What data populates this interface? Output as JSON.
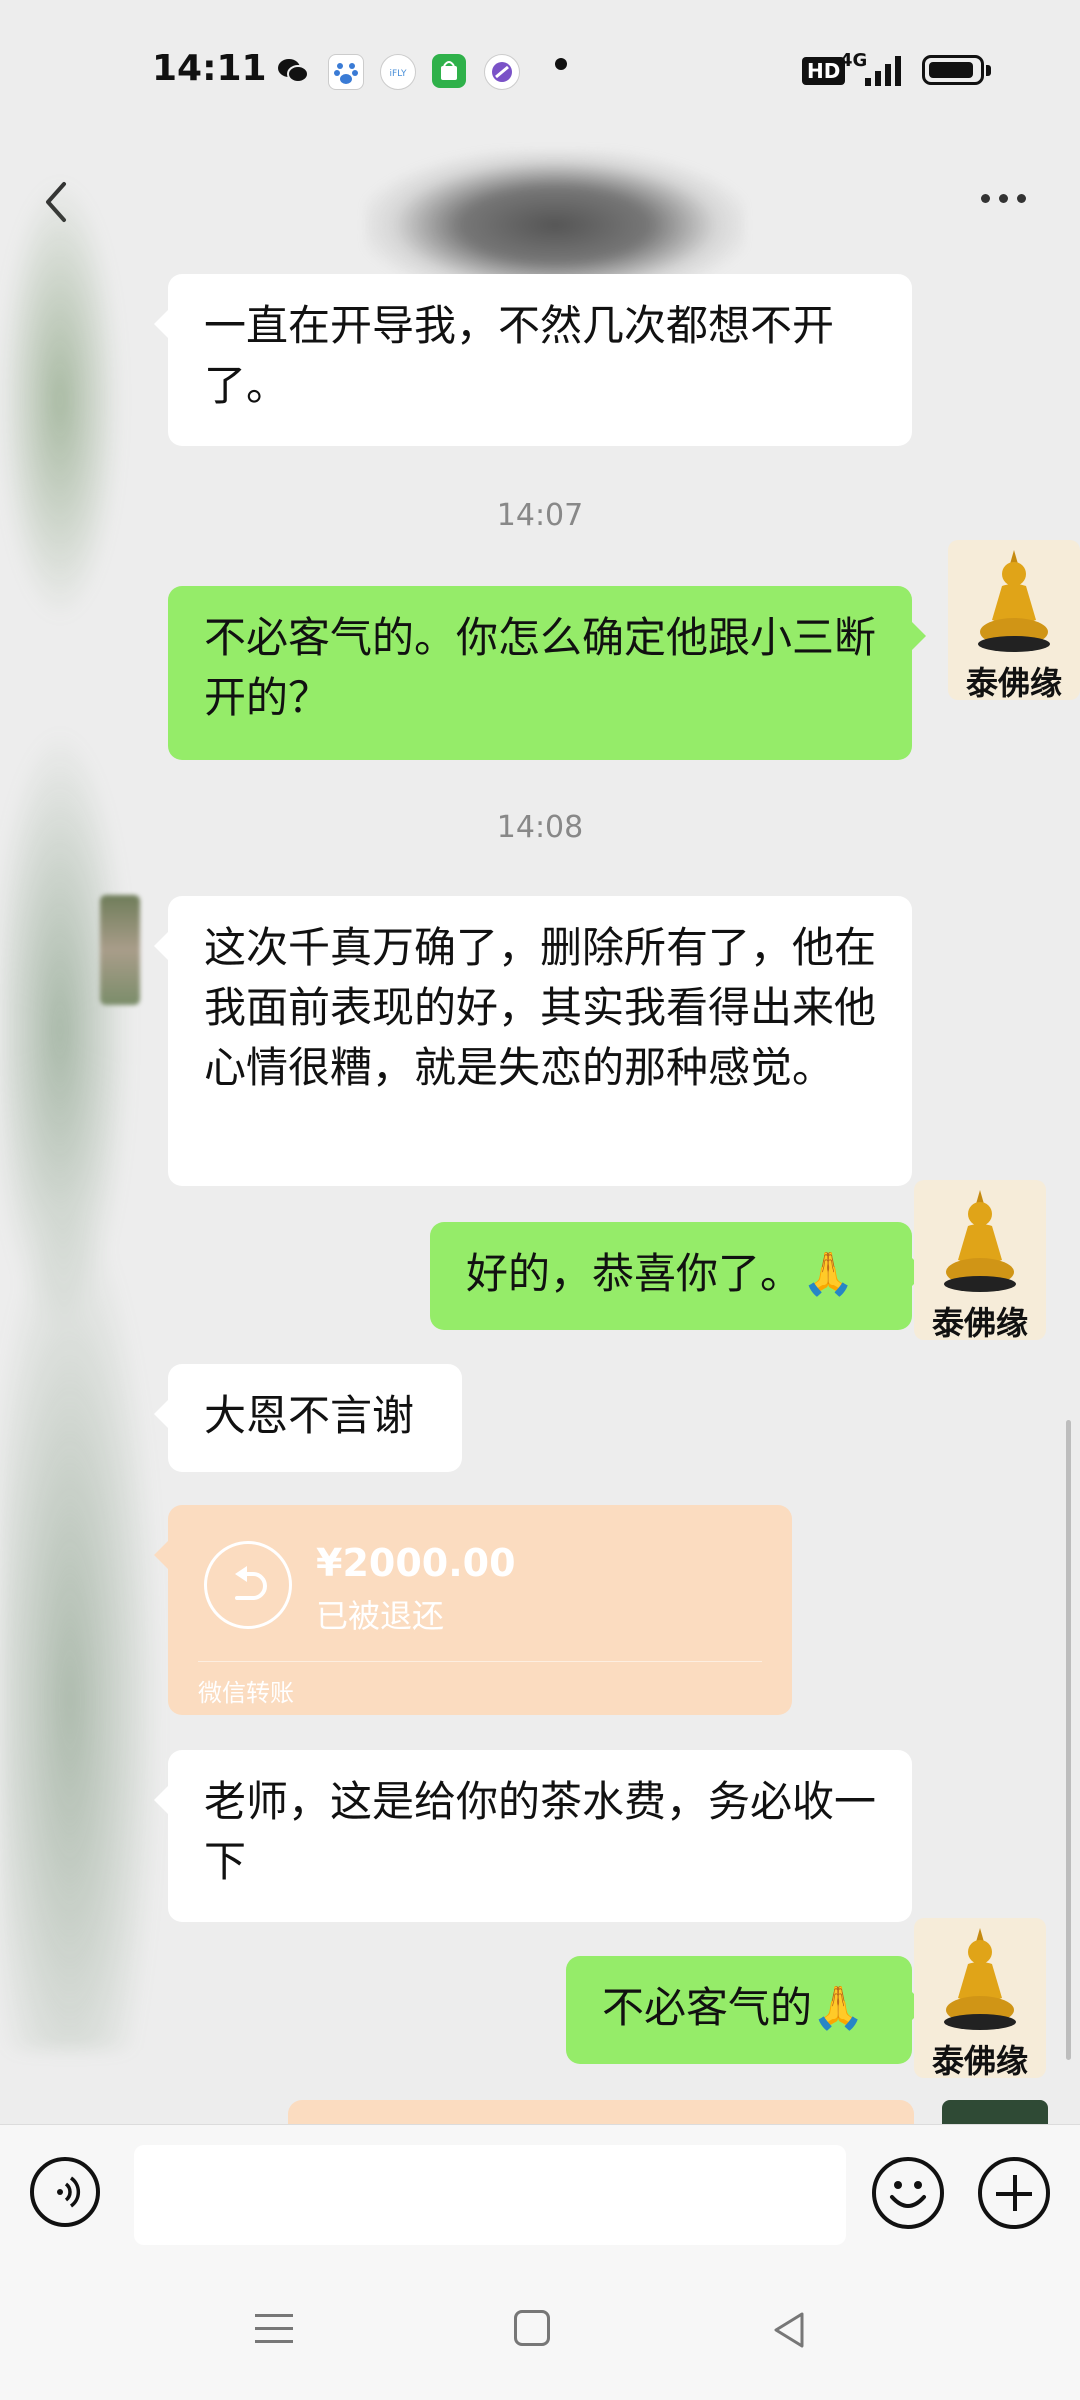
{
  "status_bar": {
    "time": "14:11",
    "app_icons": [
      {
        "name": "wechat-icon",
        "color": "#111111"
      },
      {
        "name": "baidu-icon",
        "color": "#3a7bd5"
      },
      {
        "name": "ifly-icon",
        "color": "#4a8fd8"
      },
      {
        "name": "app-store-icon",
        "color": "#2fb14a"
      },
      {
        "name": "browser-icon",
        "color": "#7a52c7"
      }
    ],
    "hd": "HD",
    "network": "4G"
  },
  "header": {
    "back_icon": "chevron-left-icon",
    "more_icon": "more-dots-icon"
  },
  "messages": [
    {
      "direction": "in",
      "text": "一直在开导我，不然几次都想不开了。"
    },
    {
      "timestamp": "14:07"
    },
    {
      "direction": "out",
      "text": "不必客气的。你怎么确定他跟小三断开的？"
    },
    {
      "timestamp": "14:08"
    },
    {
      "direction": "in",
      "text": "这次千真万确了，删除所有了，他在我面前表现的好，其实我看得出来他心情很糟，就是失恋的那种感觉。"
    },
    {
      "direction": "out",
      "text": "好的，恭喜你了。🙏"
    },
    {
      "direction": "in",
      "text": "大恩不言谢"
    },
    {
      "direction": "in",
      "type": "transfer",
      "amount": "¥2000.00",
      "status": "已被退还",
      "label": "微信转账"
    },
    {
      "direction": "in",
      "text": "老师，这是给你的茶水费，务必收一下"
    },
    {
      "direction": "out",
      "text": "不必客气的🙏"
    }
  ],
  "my_avatar": {
    "label": "泰佛缘",
    "icon": "buddha-icon"
  },
  "colors": {
    "outgoing_bubble": "#95ec69",
    "incoming_bubble": "#ffffff",
    "transfer_bubble": "#fbdcc0",
    "background": "#ededed"
  },
  "input_bar": {
    "voice_icon": "voice-icon",
    "emoji_icon": "emoji-icon",
    "plus_icon": "plus-icon",
    "placeholder": ""
  },
  "nav_bar": {
    "menu_icon": "menu-icon",
    "home_icon": "home-icon",
    "back_icon": "back-triangle-icon"
  }
}
